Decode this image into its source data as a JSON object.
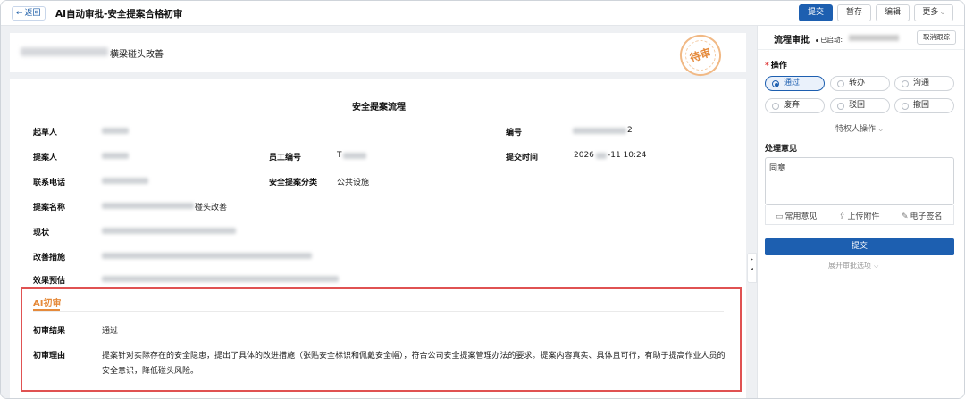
{
  "header": {
    "back_label": "返回",
    "title": "AI自动审批-安全提案合格初审",
    "submit_label": "提交",
    "save_draft_label": "暂存",
    "edit_label": "编辑",
    "more_label": "更多"
  },
  "doc": {
    "subject_suffix": "横梁碰头改善",
    "stamp_text": "待审",
    "form_title": "安全提案流程",
    "fields": {
      "drafter_label": "起草人",
      "number_label": "编号",
      "number_visible_suffix": "2",
      "proposer_label": "提案人",
      "employee_no_label": "员工编号",
      "employee_no_prefix": "T",
      "submit_time_label": "提交时间",
      "submit_time_prefix": "2026",
      "submit_time_suffix": "-11 10:24",
      "phone_label": "联系电话",
      "category_label": "安全提案分类",
      "category_value": "公共设施",
      "proposal_name_label": "提案名称",
      "proposal_name_suffix": "碰头改善",
      "current_label": "现状",
      "measures_label": "改善措施",
      "effect_label": "效果预估"
    }
  },
  "ai": {
    "tab_label": "AI初审",
    "result_label": "初审结果",
    "result_value": "通过",
    "reason_label": "初审理由",
    "reason_value": "提案针对实际存在的安全隐患，提出了具体的改进措施（张贴安全标识和佩戴安全帽），符合公司安全提案管理办法的要求。提案内容真实、具体且可行，有助于提高作业人员的安全意识，降低碰头风险。"
  },
  "sidebar": {
    "title": "流程审批",
    "status_label": "已启动:",
    "cancel_track_label": "取消跟踪",
    "operation_label": "操作",
    "options": [
      "通过",
      "转办",
      "沟通",
      "废弃",
      "驳回",
      "撤回"
    ],
    "selected_option": "通过",
    "privileged_label": "特权人操作",
    "opinion_label": "处理意见",
    "opinion_value": "同意",
    "common_opinion_label": "常用意见",
    "upload_label": "上传附件",
    "signature_label": "电子签名",
    "submit_label": "提交",
    "expand_label": "展开审批选项"
  },
  "colors": {
    "primary": "#1d5fb0",
    "stamp": "#e58a3b",
    "highlight_border": "#e05252"
  }
}
